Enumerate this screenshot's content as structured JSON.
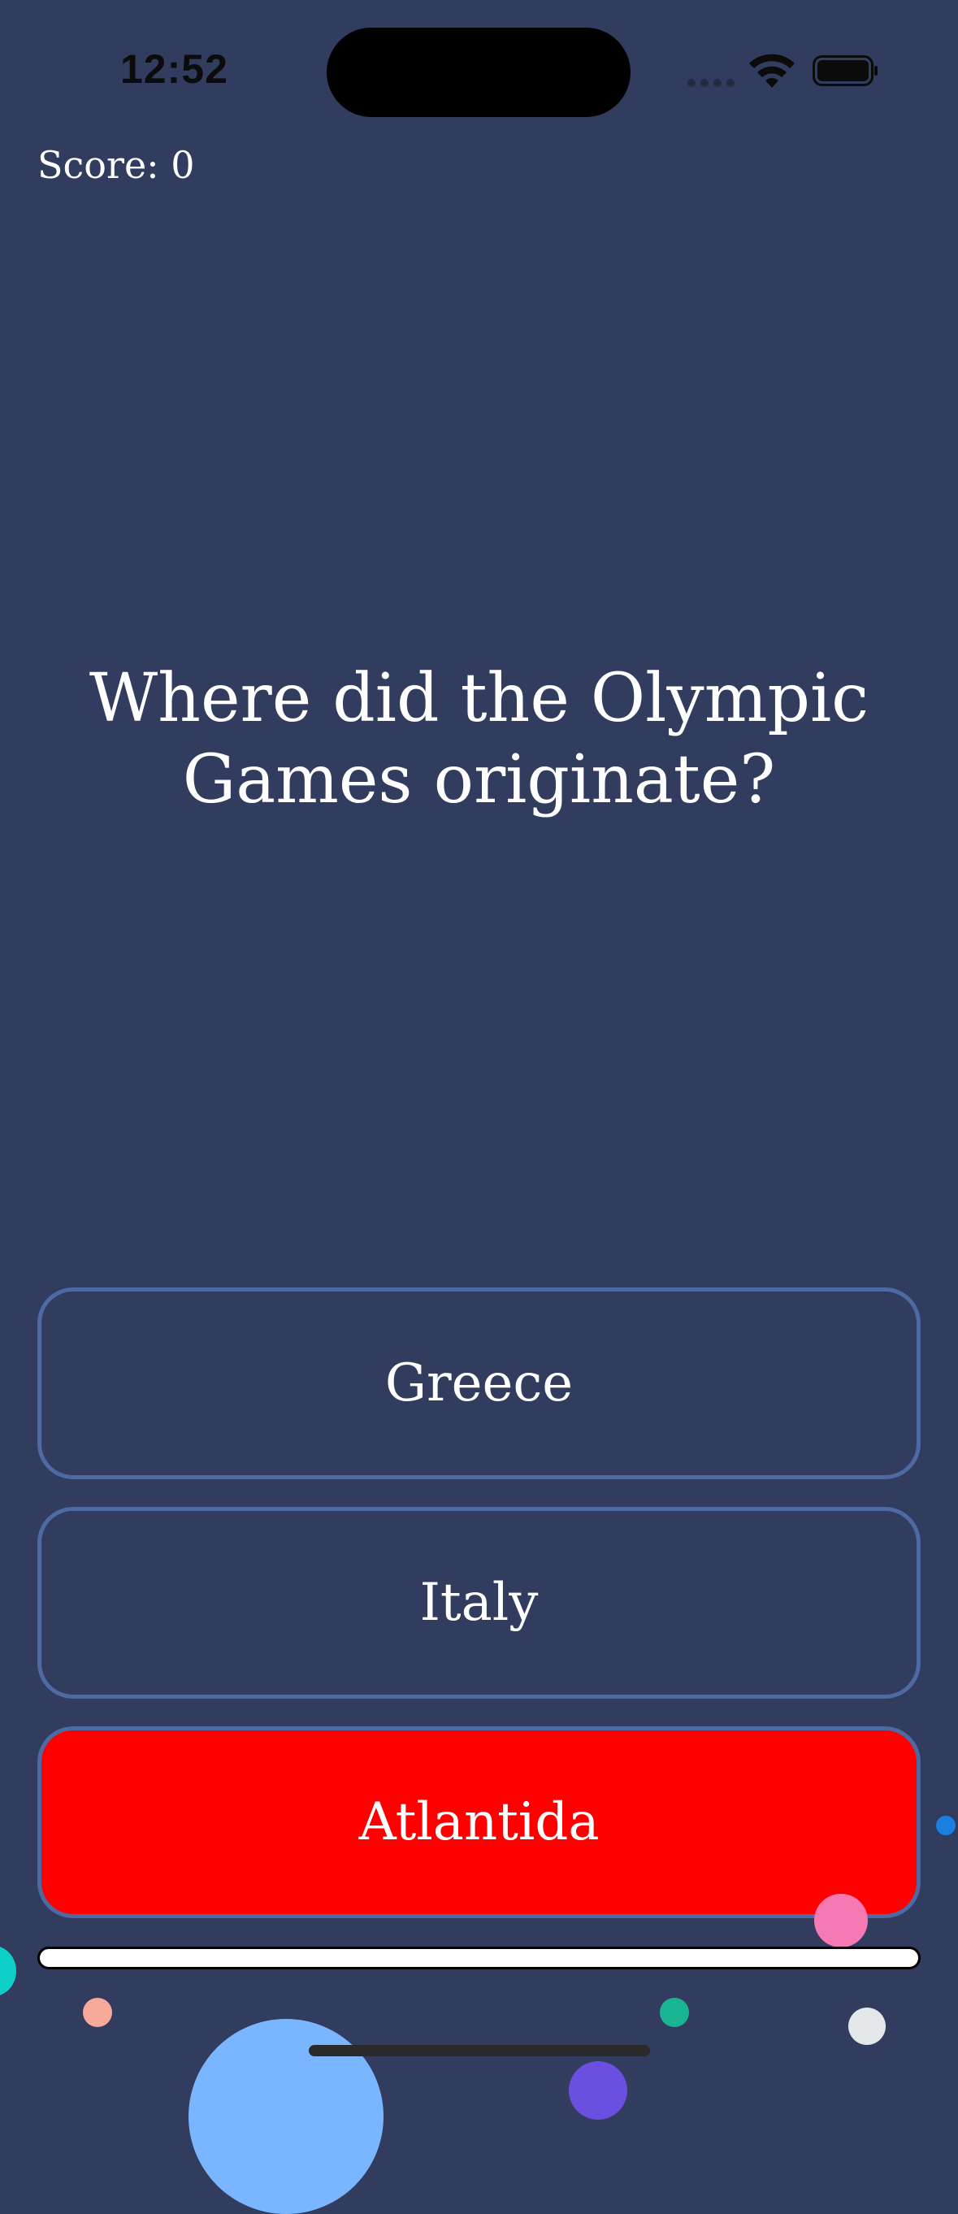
{
  "status_bar": {
    "time": "12:52"
  },
  "score": {
    "label": "Score: 0"
  },
  "question": {
    "text": "Where did the Olympic Games originate?"
  },
  "answers": [
    {
      "label": "Greece",
      "state": "default"
    },
    {
      "label": "Italy",
      "state": "default"
    },
    {
      "label": "Atlantida",
      "state": "selected-wrong"
    }
  ],
  "progress": {
    "fraction": 1.0
  },
  "colors": {
    "background": "#323c5e",
    "answer_border": "#4d6aa5",
    "wrong_answer": "#ff0000",
    "text": "#ffffff",
    "confetti": [
      "#0fd0c8",
      "#f7a99a",
      "#19b592",
      "#e4e7ea",
      "#7ab6ff",
      "#6b4fe0",
      "#f57ab3",
      "#1a7fe0"
    ]
  },
  "icons": {
    "signal": "cellular-signal-icon",
    "wifi": "wifi-icon",
    "battery": "battery-icon"
  }
}
